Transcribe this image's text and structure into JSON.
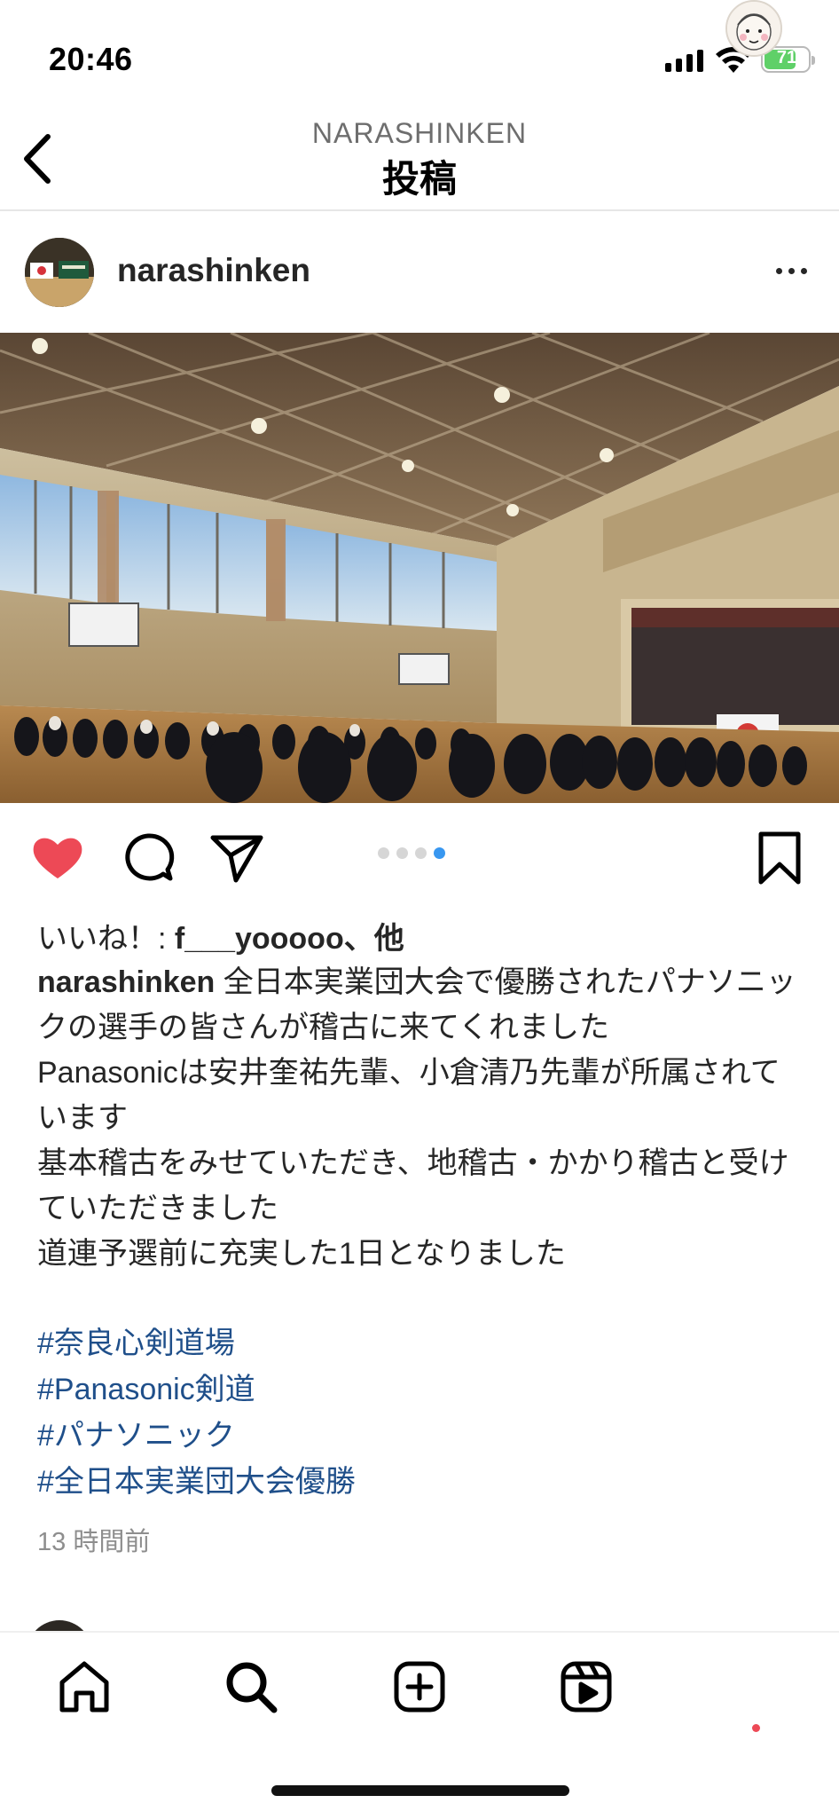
{
  "status_bar": {
    "time": "20:46",
    "battery_level": "71",
    "battery_fraction": 0.71,
    "battery_color": "#5fd068"
  },
  "nav": {
    "back_icon": "chevron-left-icon",
    "subtitle": "NARASHINKEN",
    "title": "投稿"
  },
  "post": {
    "username": "narashinken",
    "more_icon": "ellipsis-icon",
    "carousel": {
      "count": 4,
      "active_index": 4
    },
    "actions": {
      "like_icon": "heart-filled-icon",
      "like_color": "#ed4956",
      "comment_icon": "comment-icon",
      "share_icon": "paper-plane-icon",
      "save_icon": "bookmark-icon"
    },
    "likes": {
      "prefix": "いいね！: ",
      "user": "f___yooooo",
      "suffix": "、他"
    },
    "caption_lines": [
      "全日本実業団大会で優勝されたパナソニックの選手の皆さんが稽古に来てくれました",
      "Panasonicは安井奎祐先輩、小倉清乃先輩が所属されています",
      "基本稽古をみせていただき、地稽古・かかり稽古と受けていただきました",
      "道連予選前に充実した1日となりました"
    ],
    "hashtags": [
      "#奈良心剣道場",
      "#Panasonic剣道",
      "#パナソニック",
      "#全日本実業団大会優勝"
    ],
    "hashtag_color": "#1f4f8a",
    "timestamp": "13 時間前"
  },
  "tab_bar": {
    "items": [
      {
        "name": "home",
        "icon": "home-icon"
      },
      {
        "name": "search",
        "icon": "search-icon"
      },
      {
        "name": "create",
        "icon": "plus-square-icon"
      },
      {
        "name": "reels",
        "icon": "reels-icon"
      },
      {
        "name": "profile",
        "icon": "profile-avatar"
      }
    ],
    "notification_dot_color": "#ed4956"
  }
}
